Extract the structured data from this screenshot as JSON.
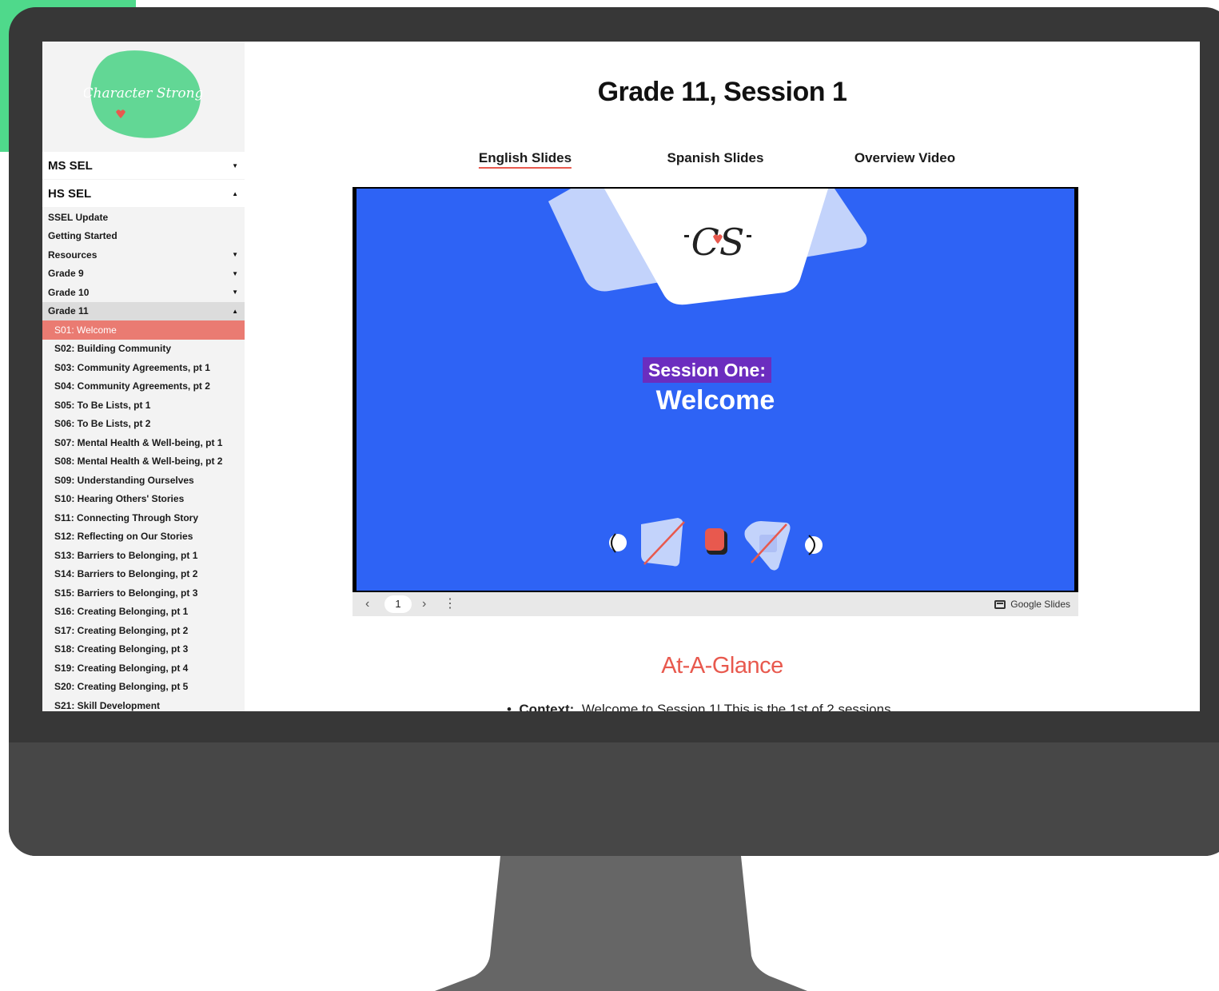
{
  "sidebar": {
    "logo_text": "Character Strong",
    "sections": [
      {
        "label": "MS SEL",
        "caret": "▼"
      },
      {
        "label": "HS SEL",
        "caret": "▲"
      }
    ],
    "items": [
      {
        "label": "SSEL Update",
        "caret": ""
      },
      {
        "label": "Getting Started",
        "caret": ""
      },
      {
        "label": "Resources",
        "caret": "▼"
      },
      {
        "label": "Grade 9",
        "caret": "▼"
      },
      {
        "label": "Grade 10",
        "caret": "▼"
      },
      {
        "label": "Grade 11",
        "caret": "▲"
      }
    ],
    "sessions": [
      "S01: Welcome",
      "S02: Building Community",
      "S03: Community Agreements, pt 1",
      "S04: Community Agreements, pt 2",
      "S05: To Be Lists, pt 1",
      "S06: To Be Lists, pt 2",
      "S07: Mental Health & Well-being, pt 1",
      "S08: Mental Health & Well-being, pt 2",
      "S09: Understanding Ourselves",
      "S10: Hearing Others' Stories",
      "S11: Connecting Through Story",
      "S12: Reflecting on Our Stories",
      "S13: Barriers to Belonging, pt 1",
      "S14: Barriers to Belonging, pt 2",
      "S15: Barriers to Belonging, pt 3",
      "S16: Creating Belonging, pt 1",
      "S17: Creating Belonging, pt 2",
      "S18: Creating Belonging, pt 3",
      "S19: Creating Belonging, pt 4",
      "S20: Creating Belonging, pt 5",
      "S21: Skill Development"
    ]
  },
  "main": {
    "title": "Grade 11, Session 1",
    "tabs": [
      {
        "label": "English Slides"
      },
      {
        "label": "Spanish Slides"
      },
      {
        "label": "Overview Video"
      }
    ],
    "slide": {
      "logo": "CS",
      "label": "Session One:",
      "title": "Welcome"
    },
    "controls": {
      "prev": "‹",
      "page": "1",
      "next": "›",
      "more": "⋮",
      "brand": "Google Slides"
    },
    "glance_heading": "At-A-Glance",
    "context_label": "Context:",
    "context_text": "Welcome to Session 1! This is the 1st of 2 sessions"
  },
  "colors": {
    "accent": "#e8594e",
    "active_item": "#ea7b72",
    "slide_bg": "#2e63f5",
    "label_bg": "#6b2dbf",
    "logo_green": "#4fd98b"
  }
}
